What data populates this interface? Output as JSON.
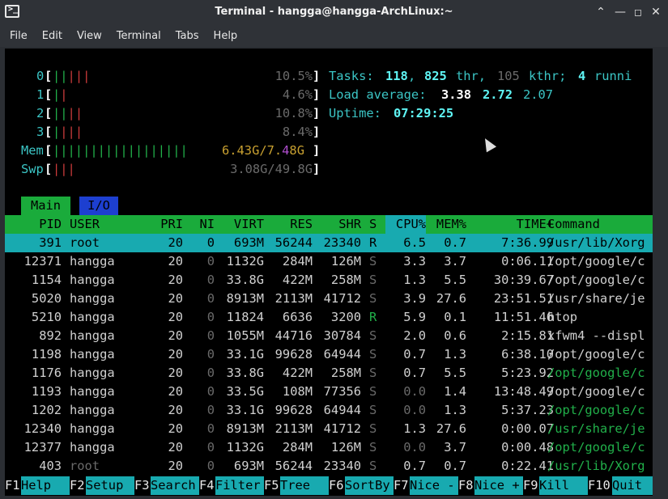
{
  "window": {
    "title": "Terminal - hangga@hangga-ArchLinux:~"
  },
  "menu": [
    "File",
    "Edit",
    "View",
    "Terminal",
    "Tabs",
    "Help"
  ],
  "meters": {
    "cpus": [
      {
        "id": "0",
        "bar": "|||||",
        "pct": "10.5%"
      },
      {
        "id": "1",
        "bar": "||",
        "pct": "4.6%"
      },
      {
        "id": "2",
        "bar": "||||",
        "pct": "10.8%"
      },
      {
        "id": "3",
        "bar": "||||",
        "pct": "8.4%"
      }
    ],
    "mem": {
      "label": "Mem",
      "bar": "||||||||||||||||||",
      "value": "6.43G/7.48G"
    },
    "swp": {
      "label": "Swp",
      "bar": "|||",
      "value": "3.08G/49.8G"
    }
  },
  "summary": {
    "tasks_label": "Tasks:",
    "tasks": "118",
    "thr": "825",
    "thr_label": "thr,",
    "kthr": "105",
    "kthr_label": "kthr;",
    "running": "4",
    "running_label": "runni",
    "load_label": "Load average:",
    "load1": "3.38",
    "load5": "2.72",
    "load15": "2.07",
    "uptime_label": "Uptime:",
    "uptime": "07:29:25"
  },
  "tabs": {
    "main": "Main",
    "io": "I/O"
  },
  "columns": [
    "PID",
    "USER",
    "PRI",
    "NI",
    "VIRT",
    "RES",
    "SHR",
    "S",
    "CPU%",
    "MEM%",
    "TIME+",
    "Command"
  ],
  "processes": [
    {
      "pid": "391",
      "user": "root",
      "pri": "20",
      "ni": "0",
      "virt": "693M",
      "res": "56244",
      "shr": "23340",
      "s": "R",
      "cpu": "6.5",
      "mem": "0.7",
      "time": "7:36.99",
      "cmd": "/usr/lib/Xorg",
      "selected": true
    },
    {
      "pid": "12371",
      "user": "hangga",
      "pri": "20",
      "ni": "0",
      "virt": "1132G",
      "res": "284M",
      "shr": "126M",
      "s": "S",
      "cpu": "3.3",
      "mem": "3.7",
      "time": "0:06.11",
      "cmd": "/opt/google/c"
    },
    {
      "pid": "1154",
      "user": "hangga",
      "pri": "20",
      "ni": "0",
      "virt": "33.8G",
      "res": "422M",
      "shr": "258M",
      "s": "S",
      "cpu": "1.3",
      "mem": "5.5",
      "time": "30:39.67",
      "cmd": "/opt/google/c"
    },
    {
      "pid": "5020",
      "user": "hangga",
      "pri": "20",
      "ni": "0",
      "virt": "8913M",
      "res": "2113M",
      "shr": "41712",
      "s": "S",
      "cpu": "3.9",
      "mem": "27.6",
      "time": "23:51.51",
      "cmd": "/usr/share/je"
    },
    {
      "pid": "5210",
      "user": "hangga",
      "pri": "20",
      "ni": "0",
      "virt": "11824",
      "res": "6636",
      "shr": "3200",
      "s": "R",
      "cpu": "5.9",
      "mem": "0.1",
      "time": "11:51.46",
      "cmd": "htop"
    },
    {
      "pid": "892",
      "user": "hangga",
      "pri": "20",
      "ni": "0",
      "virt": "1055M",
      "res": "44716",
      "shr": "30784",
      "s": "S",
      "cpu": "2.0",
      "mem": "0.6",
      "time": "2:15.81",
      "cmd": "xfwm4 --displ"
    },
    {
      "pid": "1198",
      "user": "hangga",
      "pri": "20",
      "ni": "0",
      "virt": "33.1G",
      "res": "99628",
      "shr": "64944",
      "s": "S",
      "cpu": "0.7",
      "mem": "1.3",
      "time": "6:38.10",
      "cmd": "/opt/google/c"
    },
    {
      "pid": "1176",
      "user": "hangga",
      "pri": "20",
      "ni": "0",
      "virt": "33.8G",
      "res": "422M",
      "shr": "258M",
      "s": "S",
      "cpu": "0.7",
      "mem": "5.5",
      "time": "5:23.92",
      "cmd": "/opt/google/c",
      "thread": true
    },
    {
      "pid": "1193",
      "user": "hangga",
      "pri": "20",
      "ni": "0",
      "virt": "33.5G",
      "res": "108M",
      "shr": "77356",
      "s": "S",
      "cpu": "0.0",
      "mem": "1.4",
      "time": "13:48.49",
      "cmd": "/opt/google/c"
    },
    {
      "pid": "1202",
      "user": "hangga",
      "pri": "20",
      "ni": "0",
      "virt": "33.1G",
      "res": "99628",
      "shr": "64944",
      "s": "S",
      "cpu": "0.0",
      "mem": "1.3",
      "time": "5:37.23",
      "cmd": "/opt/google/c",
      "thread": true
    },
    {
      "pid": "12340",
      "user": "hangga",
      "pri": "20",
      "ni": "0",
      "virt": "8913M",
      "res": "2113M",
      "shr": "41712",
      "s": "S",
      "cpu": "1.3",
      "mem": "27.6",
      "time": "0:00.07",
      "cmd": "/usr/share/je",
      "thread": true
    },
    {
      "pid": "12377",
      "user": "hangga",
      "pri": "20",
      "ni": "0",
      "virt": "1132G",
      "res": "284M",
      "shr": "126M",
      "s": "S",
      "cpu": "0.0",
      "mem": "3.7",
      "time": "0:00.48",
      "cmd": "/opt/google/c",
      "thread": true
    },
    {
      "pid": "403",
      "user": "root",
      "pri": "20",
      "ni": "0",
      "virt": "693M",
      "res": "56244",
      "shr": "23340",
      "s": "S",
      "cpu": "0.7",
      "mem": "0.7",
      "time": "0:22.41",
      "cmd": "/usr/lib/Xorg",
      "thread": true
    }
  ],
  "fkeys": [
    {
      "key": "F1",
      "label": "Help"
    },
    {
      "key": "F2",
      "label": "Setup"
    },
    {
      "key": "F3",
      "label": "Search"
    },
    {
      "key": "F4",
      "label": "Filter"
    },
    {
      "key": "F5",
      "label": "Tree"
    },
    {
      "key": "F6",
      "label": "SortBy"
    },
    {
      "key": "F7",
      "label": "Nice -"
    },
    {
      "key": "F8",
      "label": "Nice +"
    },
    {
      "key": "F9",
      "label": "Kill"
    },
    {
      "key": "F10",
      "label": "Quit"
    }
  ]
}
